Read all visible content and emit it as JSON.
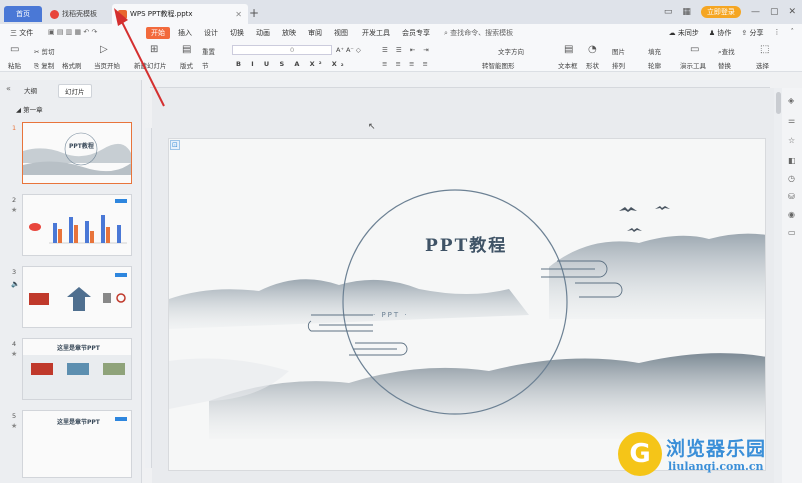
{
  "tabs": {
    "home": "首页",
    "template": "找稻壳模板",
    "document": "WPS PPT教程.pptx"
  },
  "window": {
    "login": "立即登录"
  },
  "menu": {
    "file": "三 文件",
    "items": [
      "开始",
      "插入",
      "设计",
      "切换",
      "动画",
      "放映",
      "审阅",
      "视图",
      "开发工具",
      "会员专享"
    ],
    "search": "查找命令、搜索模板",
    "right": [
      "未同步",
      "协作",
      "分享"
    ]
  },
  "ribbon": {
    "paste": "粘贴",
    "cut": "剪切",
    "copy": "复制",
    "format_painter": "格式刷",
    "play_from_current": "当页开始",
    "new_slide": "新建幻灯片",
    "layout": "版式",
    "section": "节",
    "reset": "重置",
    "font_size": "0",
    "text_box": "文本框",
    "shape": "形状",
    "arrange": "排列",
    "picture": "图片",
    "fill": "填充",
    "outline": "轮廓",
    "presentation_tools": "演示工具",
    "find": "查找",
    "replace": "替换",
    "select": "选择",
    "convert_art": "转智能图形",
    "text_direction": "文字方向"
  },
  "left_panel": {
    "tab_outline": "大纲",
    "tab_slides": "幻灯片",
    "section": "第一章",
    "slides": [
      {
        "num": "1",
        "title": "PPT教程"
      },
      {
        "num": "2",
        "title": ""
      },
      {
        "num": "3",
        "title": ""
      },
      {
        "num": "4",
        "title": "这里是章节PPT"
      },
      {
        "num": "5",
        "title": "这里是章节PPT"
      }
    ]
  },
  "slide": {
    "title": "PPT教程",
    "subtitle": "· PPT ·"
  },
  "watermark": {
    "logo": "G",
    "text": "浏览器乐园",
    "url": "liulanqi.com.cn"
  }
}
